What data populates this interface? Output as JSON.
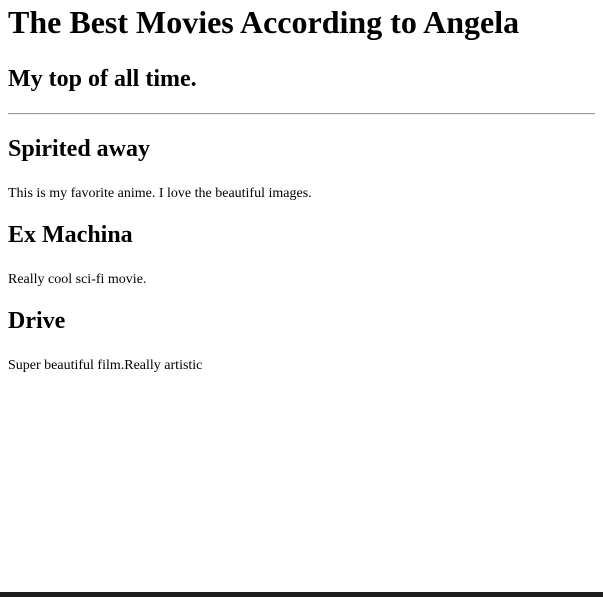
{
  "header": {
    "title": "The Best Movies According to Angela",
    "subtitle": "My top of all time."
  },
  "movies": [
    {
      "title": "Spirited away",
      "description": "This is my favorite anime. I love the beautiful images."
    },
    {
      "title": "Ex Machina",
      "description": "Really cool sci-fi movie."
    },
    {
      "title": "Drive",
      "description": "Super beautiful film.Really artistic"
    }
  ],
  "colors": {
    "text": "#000000",
    "background": "#ffffff",
    "divider": "#9a9a9a",
    "bottom_bar": "#1e1e1e"
  }
}
